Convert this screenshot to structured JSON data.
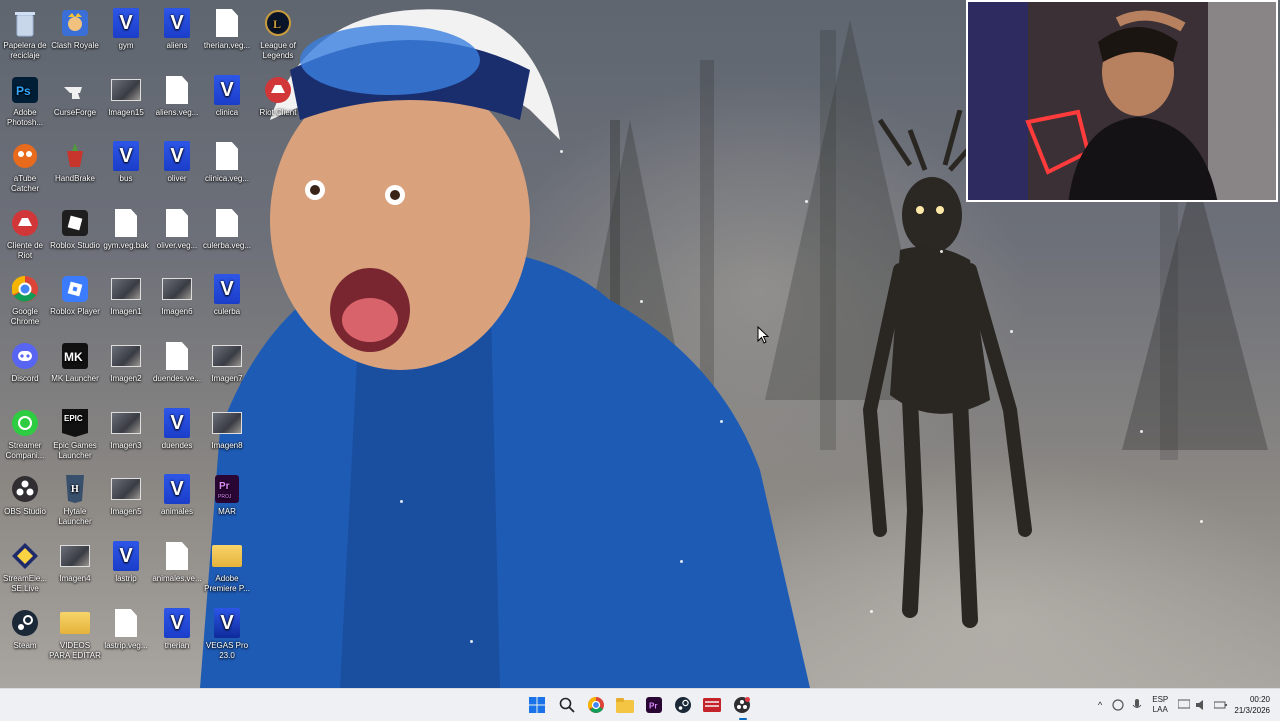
{
  "desktop": {
    "icons": [
      {
        "label": "Papelera de reciclaje",
        "icon": "recycle-bin-icon"
      },
      {
        "label": "Clash Royale",
        "icon": "clash-royale-icon"
      },
      {
        "label": "gym",
        "icon": "vegas-project-icon"
      },
      {
        "label": "aliens",
        "icon": "vegas-project-icon"
      },
      {
        "label": "therian.veg...",
        "icon": "file-icon"
      },
      {
        "label": "League of Legends",
        "icon": "league-of-legends-icon"
      },
      {
        "label": "Adobe Photosh...",
        "icon": "photoshop-icon"
      },
      {
        "label": "CurseForge",
        "icon": "curseforge-icon"
      },
      {
        "label": "Imagen15",
        "icon": "image-thumbnail-icon"
      },
      {
        "label": "aliens.veg...",
        "icon": "file-icon"
      },
      {
        "label": "clinica",
        "icon": "vegas-project-icon"
      },
      {
        "label": "Riot Client",
        "icon": "riot-client-icon"
      },
      {
        "label": "aTube Catcher",
        "icon": "atube-catcher-icon"
      },
      {
        "label": "HandBrake",
        "icon": "handbrake-icon"
      },
      {
        "label": "bus",
        "icon": "vegas-project-icon"
      },
      {
        "label": "oliver",
        "icon": "vegas-project-icon"
      },
      {
        "label": "clinica.veg...",
        "icon": "file-icon"
      },
      {
        "label": "Cliente de Riot",
        "icon": "riot-client-icon"
      },
      {
        "label": "Roblox Studio",
        "icon": "roblox-studio-icon"
      },
      {
        "label": "gym.veg.bak",
        "icon": "file-icon"
      },
      {
        "label": "oliver.veg...",
        "icon": "file-icon"
      },
      {
        "label": "culerba.veg...",
        "icon": "file-icon"
      },
      {
        "label": "Google Chrome",
        "icon": "chrome-icon"
      },
      {
        "label": "Roblox Player",
        "icon": "roblox-player-icon"
      },
      {
        "label": "Imagen1",
        "icon": "image-thumbnail-icon"
      },
      {
        "label": "Imagen6",
        "icon": "image-thumbnail-icon"
      },
      {
        "label": "culerba",
        "icon": "vegas-project-icon"
      },
      {
        "label": "Discord",
        "icon": "discord-icon"
      },
      {
        "label": "MK Launcher",
        "icon": "mk-launcher-icon"
      },
      {
        "label": "Imagen2",
        "icon": "image-thumbnail-icon"
      },
      {
        "label": "duendes.ve...",
        "icon": "file-icon"
      },
      {
        "label": "Imagen7",
        "icon": "image-thumbnail-icon"
      },
      {
        "label": "Streamer Compani...",
        "icon": "streamer-companion-icon"
      },
      {
        "label": "Epic Games Launcher",
        "icon": "epic-games-icon"
      },
      {
        "label": "Imagen3",
        "icon": "image-thumbnail-icon"
      },
      {
        "label": "duendes",
        "icon": "vegas-project-icon"
      },
      {
        "label": "Imagen8",
        "icon": "image-thumbnail-icon"
      },
      {
        "label": "OBS Studio",
        "icon": "obs-studio-icon"
      },
      {
        "label": "Hytale Launcher",
        "icon": "hytale-icon"
      },
      {
        "label": "Imagen5",
        "icon": "image-thumbnail-icon"
      },
      {
        "label": "animales",
        "icon": "vegas-project-icon"
      },
      {
        "label": "MAR",
        "icon": "premiere-project-icon"
      },
      {
        "label": "StreamEle... SE.Live",
        "icon": "streamelements-icon"
      },
      {
        "label": "Imagen4",
        "icon": "image-thumbnail-icon"
      },
      {
        "label": "lastrip",
        "icon": "vegas-project-icon"
      },
      {
        "label": "animales.ve...",
        "icon": "file-icon"
      },
      {
        "label": "Adobe Premiere P...",
        "icon": "folder-icon"
      },
      {
        "label": "Steam",
        "icon": "steam-icon"
      },
      {
        "label": "VIDEOS PARA EDITAR",
        "icon": "folder-icon"
      },
      {
        "label": "lastrip.veg...",
        "icon": "file-icon"
      },
      {
        "label": "therian",
        "icon": "vegas-project-icon"
      },
      {
        "label": "VEGAS Pro 23.0",
        "icon": "vegas-pro-icon"
      }
    ]
  },
  "taskbar": {
    "pinned": [
      {
        "name": "start-button",
        "icon": "windows-start-icon"
      },
      {
        "name": "search-button",
        "icon": "search-icon"
      },
      {
        "name": "chrome-taskbar",
        "icon": "chrome-icon"
      },
      {
        "name": "file-explorer-taskbar",
        "icon": "folder-icon"
      },
      {
        "name": "premiere-taskbar",
        "icon": "premiere-icon"
      },
      {
        "name": "steam-taskbar",
        "icon": "steam-icon"
      },
      {
        "name": "video-app-taskbar",
        "icon": "video-app-icon"
      },
      {
        "name": "obs-taskbar",
        "icon": "obs-studio-icon"
      }
    ],
    "tray": {
      "language": "ESP",
      "layout": "LAA",
      "time": "00:20",
      "date": "21/3/2026"
    }
  },
  "colors": {
    "vegas_blue": "#2d56e8",
    "taskbar_bg": "#eef0f4"
  }
}
